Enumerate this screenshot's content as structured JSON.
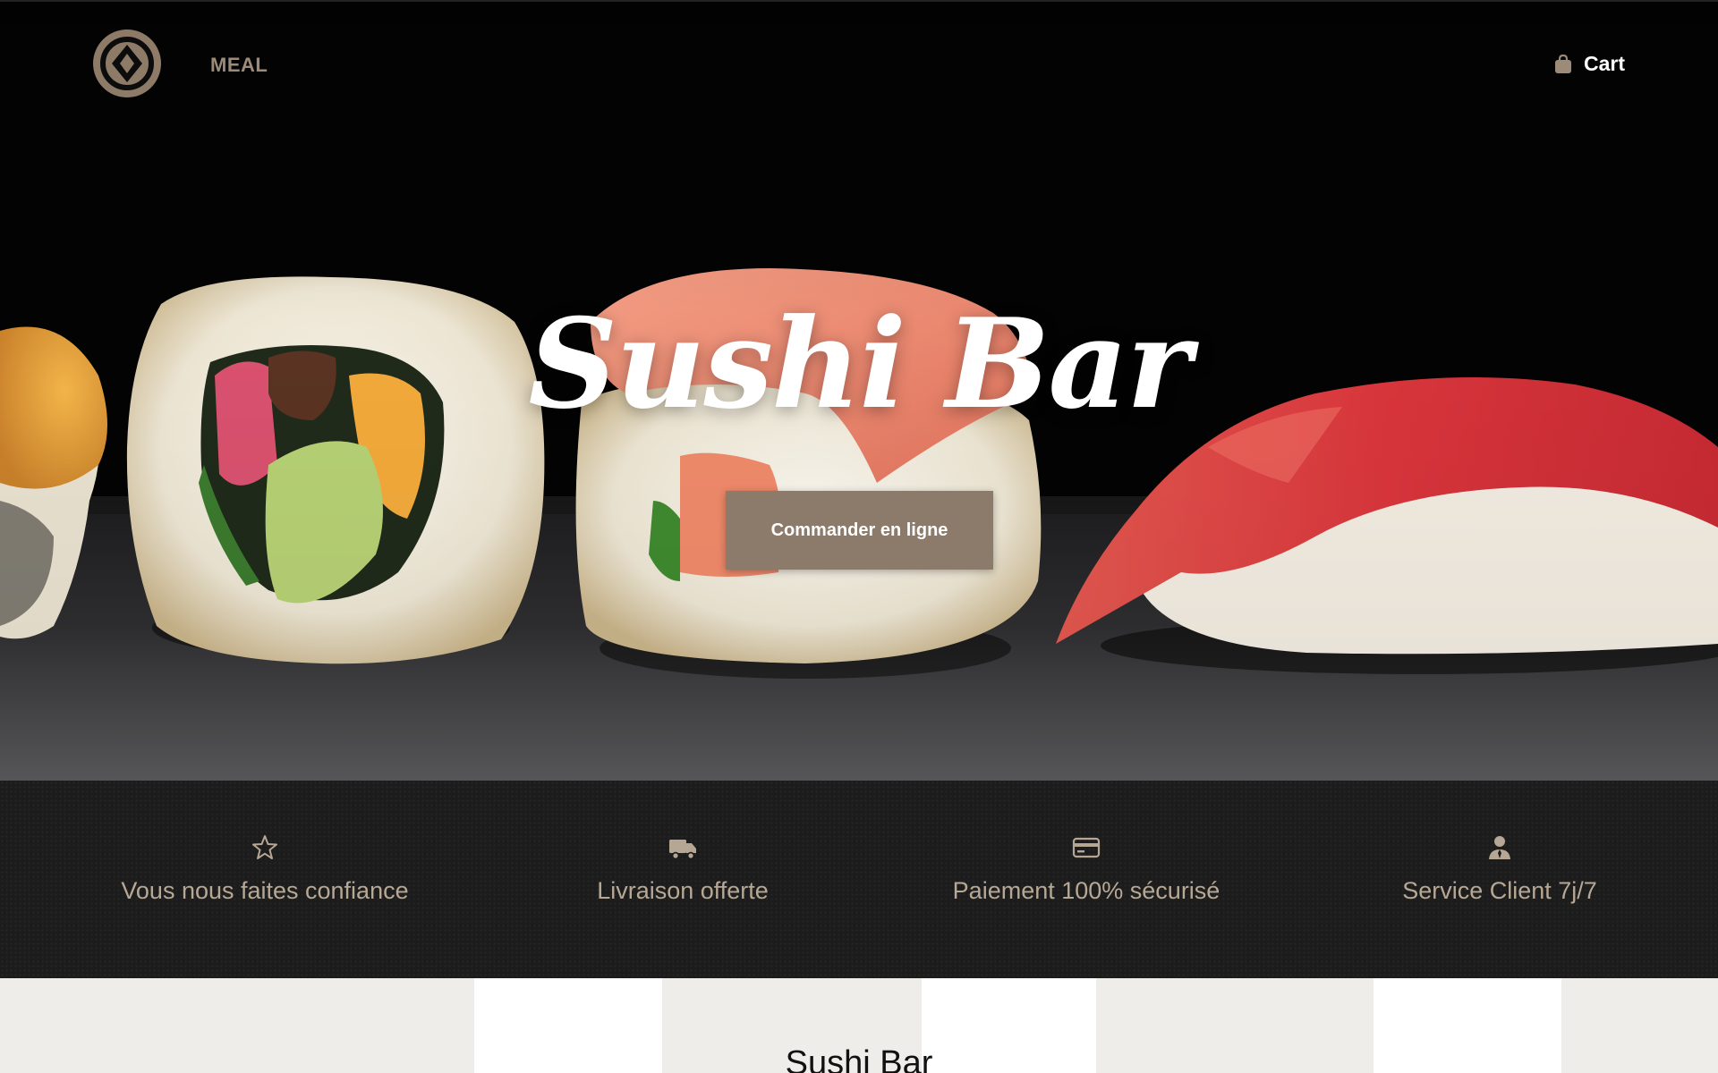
{
  "header": {
    "brand": "MEAL",
    "cart_label": "Cart"
  },
  "hero": {
    "title": "Sushi Bar",
    "cta_label": "Commander en ligne"
  },
  "features": [
    {
      "icon": "star-icon",
      "label": "Vous nous faites confiance"
    },
    {
      "icon": "truck-icon",
      "label": "Livraison offerte"
    },
    {
      "icon": "credit-card-icon",
      "label": "Paiement 100% sécurisé"
    },
    {
      "icon": "support-agent-icon",
      "label": "Service Client 7j/7"
    }
  ],
  "section": {
    "title": "Sushi Bar"
  },
  "colors": {
    "accent": "#8c7b6a",
    "brand_text": "#9c8b78",
    "feature_text": "#b7a895",
    "features_bg": "#1c1c1c",
    "lower_bg": "#efede9"
  }
}
